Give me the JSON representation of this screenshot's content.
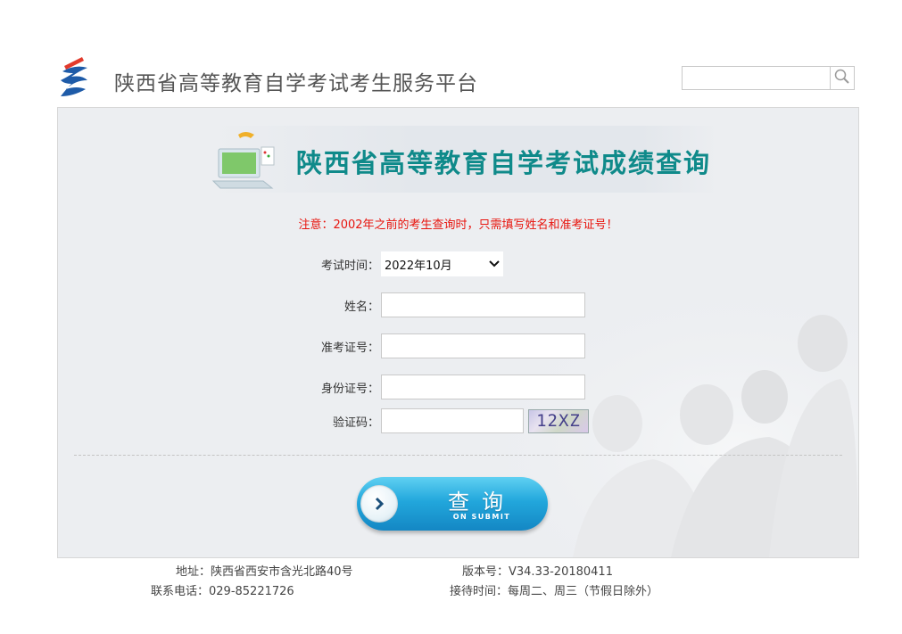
{
  "header": {
    "site_title": "陕西省高等教育自学考试考生服务平台",
    "search_placeholder": "",
    "search_icon": "search-icon"
  },
  "banner": {
    "title": "陕西省高等教育自学考试成绩查询",
    "icon": "computer-graphic-icon"
  },
  "notice": "注意：2002年之前的考生查询时，只需填写姓名和准考证号！",
  "form": {
    "exam_time_label": "考试时间：",
    "exam_time_value": "2022年10月",
    "name_label": "姓名：",
    "ticket_label": "准考证号：",
    "id_label": "身份证号：",
    "captcha_label": "验证码：",
    "captcha_text": "12XZ"
  },
  "submit": {
    "label": "查询",
    "sub_label": "ON SUBMIT"
  },
  "footer": {
    "address": "地址：陕西省西安市含光北路40号",
    "phone": "联系电话：029-85221726",
    "version": "版本号：V34.33-20180411",
    "reception": "接待时间：每周二、周三（节假日除外）"
  },
  "colors": {
    "banner_title": "#0f8a8a",
    "notice": "#e8140d",
    "button": "#22a7dc"
  }
}
